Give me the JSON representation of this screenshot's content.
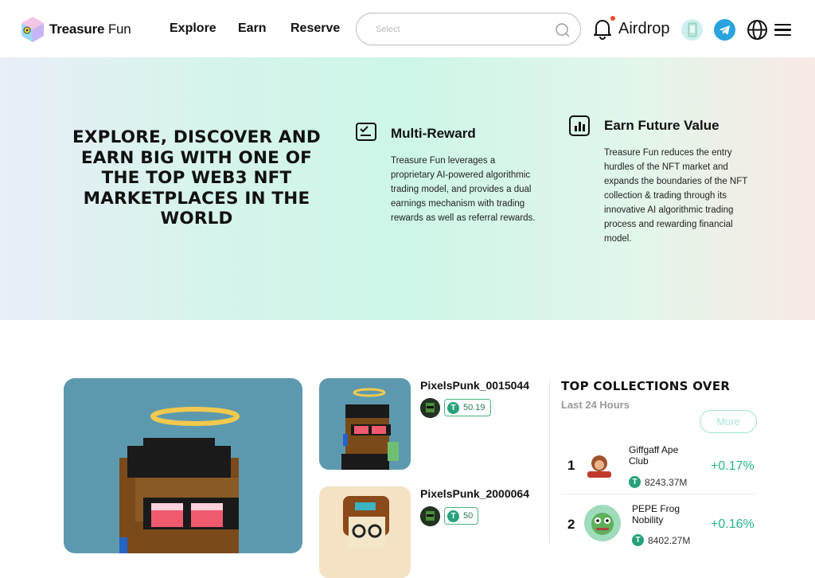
{
  "header": {
    "brand_bold": "Treasure",
    "brand_light": "Fun",
    "nav": [
      "Explore",
      "Earn",
      "Reserve"
    ],
    "search_placeholder": "Select",
    "airdrop_label": "Airdrop",
    "icons": [
      "bell-icon",
      "phone-icon",
      "telegram-icon",
      "globe-icon",
      "menu-icon"
    ]
  },
  "hero": {
    "headline": "EXPLORE, DISCOVER AND EARN BIG WITH ONE OF THE TOP WEB3 NFT MARKETPLACES IN THE WORLD",
    "features": [
      {
        "title": "Multi-Reward",
        "text": "Treasure Fun leverages a proprietary AI-powered algorithmic trading model, and provides a dual earnings mechanism with trading rewards as well as referral rewards.",
        "icon": "checklist-icon"
      },
      {
        "title": "Earn Future Value",
        "text": "Treasure Fun reduces the entry hurdles of the NFT market and expands the boundaries of the NFT collection & trading through its innovative AI algorithmic trading process and rewarding financial model.",
        "icon": "bar-chart-icon"
      }
    ]
  },
  "nfts": [
    {
      "name": "PixelsPunk_0015044",
      "price": "50.19"
    },
    {
      "name": "PixelsPunk_2000064",
      "price": "50"
    }
  ],
  "top_collections": {
    "title": "TOP COLLECTIONS OVER",
    "subtitle": "Last 24 Hours",
    "more_label": "More",
    "items": [
      {
        "rank": "1",
        "name": "Giffgaff Ape Club",
        "volume": "8243.37M",
        "change": "+0.17%"
      },
      {
        "rank": "2",
        "name": "PEPE Frog Nobility",
        "volume": "8402.27M",
        "change": "+0.16%"
      }
    ]
  },
  "colors": {
    "accent": "#26b58a",
    "usdt": "#26a17b",
    "chip_border": "#4bb37e",
    "alert_dot": "#f04a2a",
    "telegram": "#2aa3dd"
  }
}
